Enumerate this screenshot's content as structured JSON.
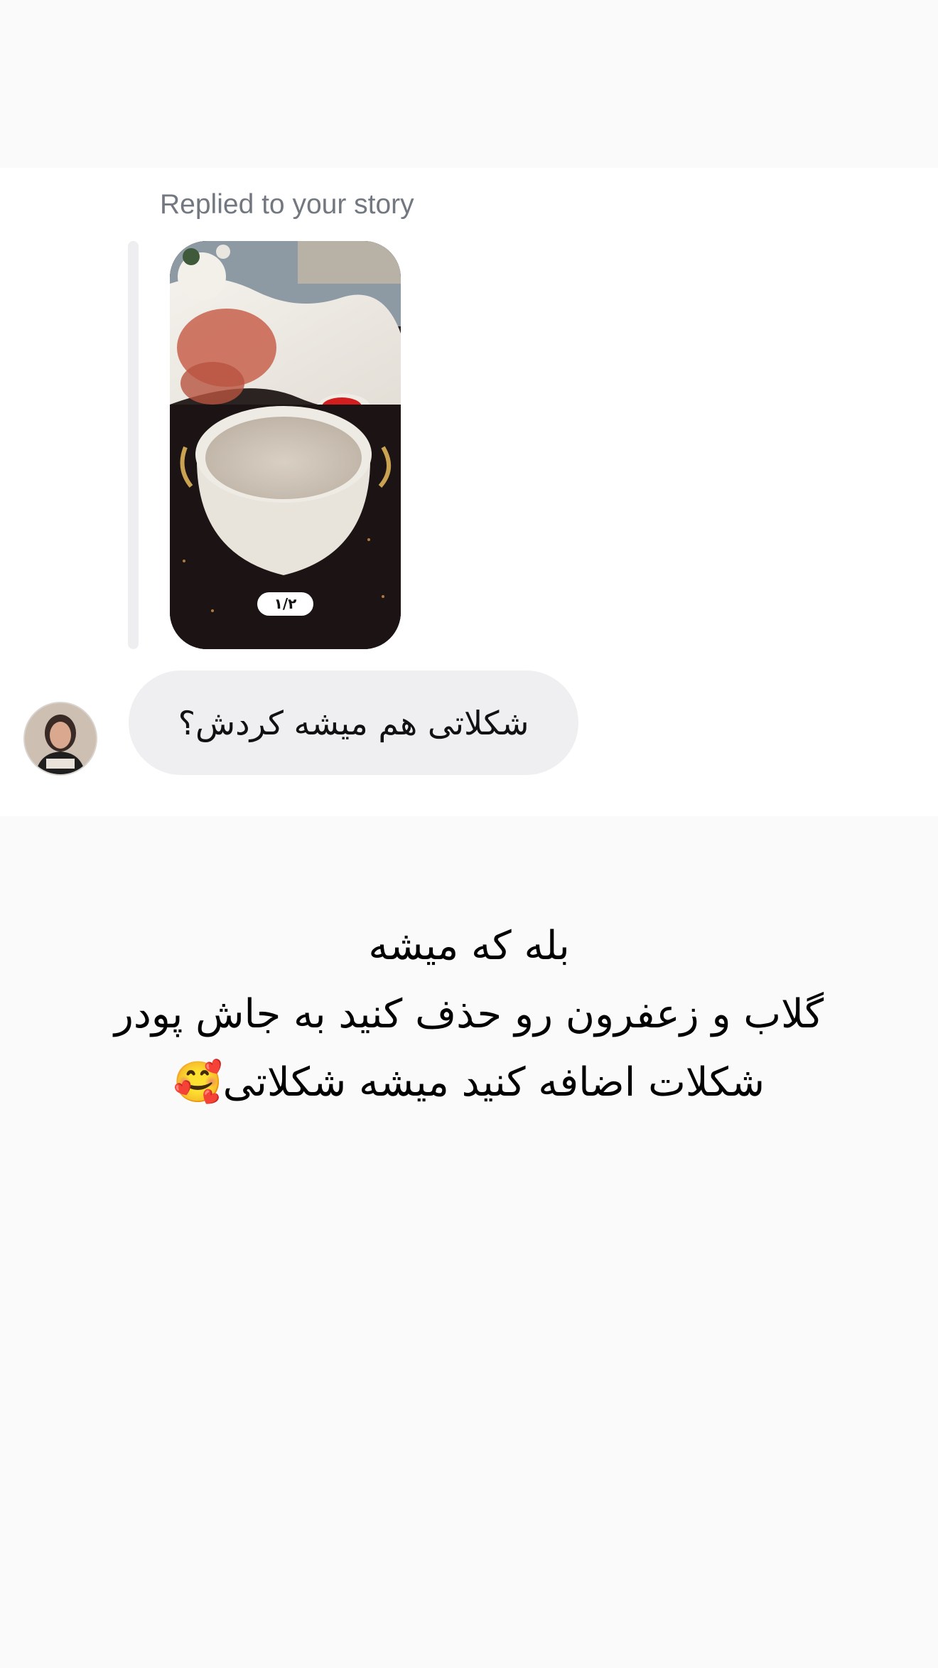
{
  "conversation": {
    "reply_context_label": "Replied to your story",
    "story": {
      "pager": "۱/۲",
      "thumbnail": "story-photo-pot"
    },
    "incoming_message": "شکلاتی هم میشه کردش؟",
    "sender_avatar": "avatar-photo"
  },
  "answer_text": {
    "lines": [
      "بله که میشه",
      "گلاب و زعفرون رو حذف کنید به جاش پودر",
      "شکلات اضافه کنید میشه شکلاتی"
    ],
    "emoji": "🥰"
  },
  "colors": {
    "background": "#fafafa",
    "card": "#ffffff",
    "bubble": "#efeff2",
    "muted_text": "#737880"
  }
}
